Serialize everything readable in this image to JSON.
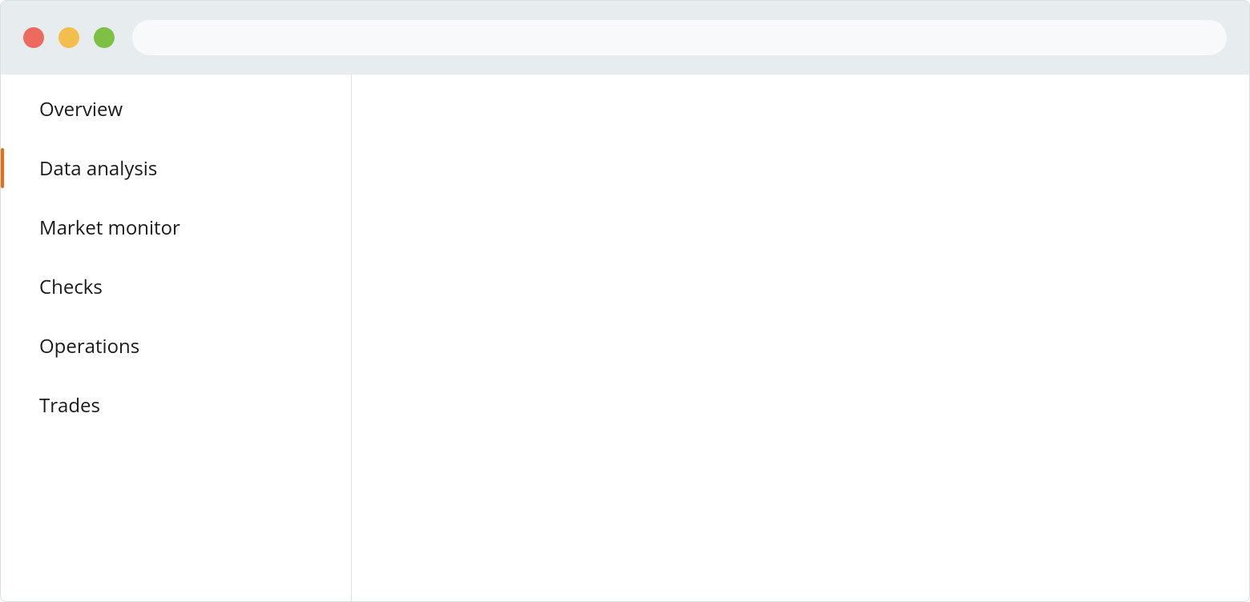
{
  "titlebar": {
    "address_value": ""
  },
  "sidebar": {
    "items": [
      {
        "label": "Overview",
        "active": false
      },
      {
        "label": "Data analysis",
        "active": true
      },
      {
        "label": "Market monitor",
        "active": false
      },
      {
        "label": "Checks",
        "active": false
      },
      {
        "label": "Operations",
        "active": false
      },
      {
        "label": "Trades",
        "active": false
      }
    ]
  }
}
